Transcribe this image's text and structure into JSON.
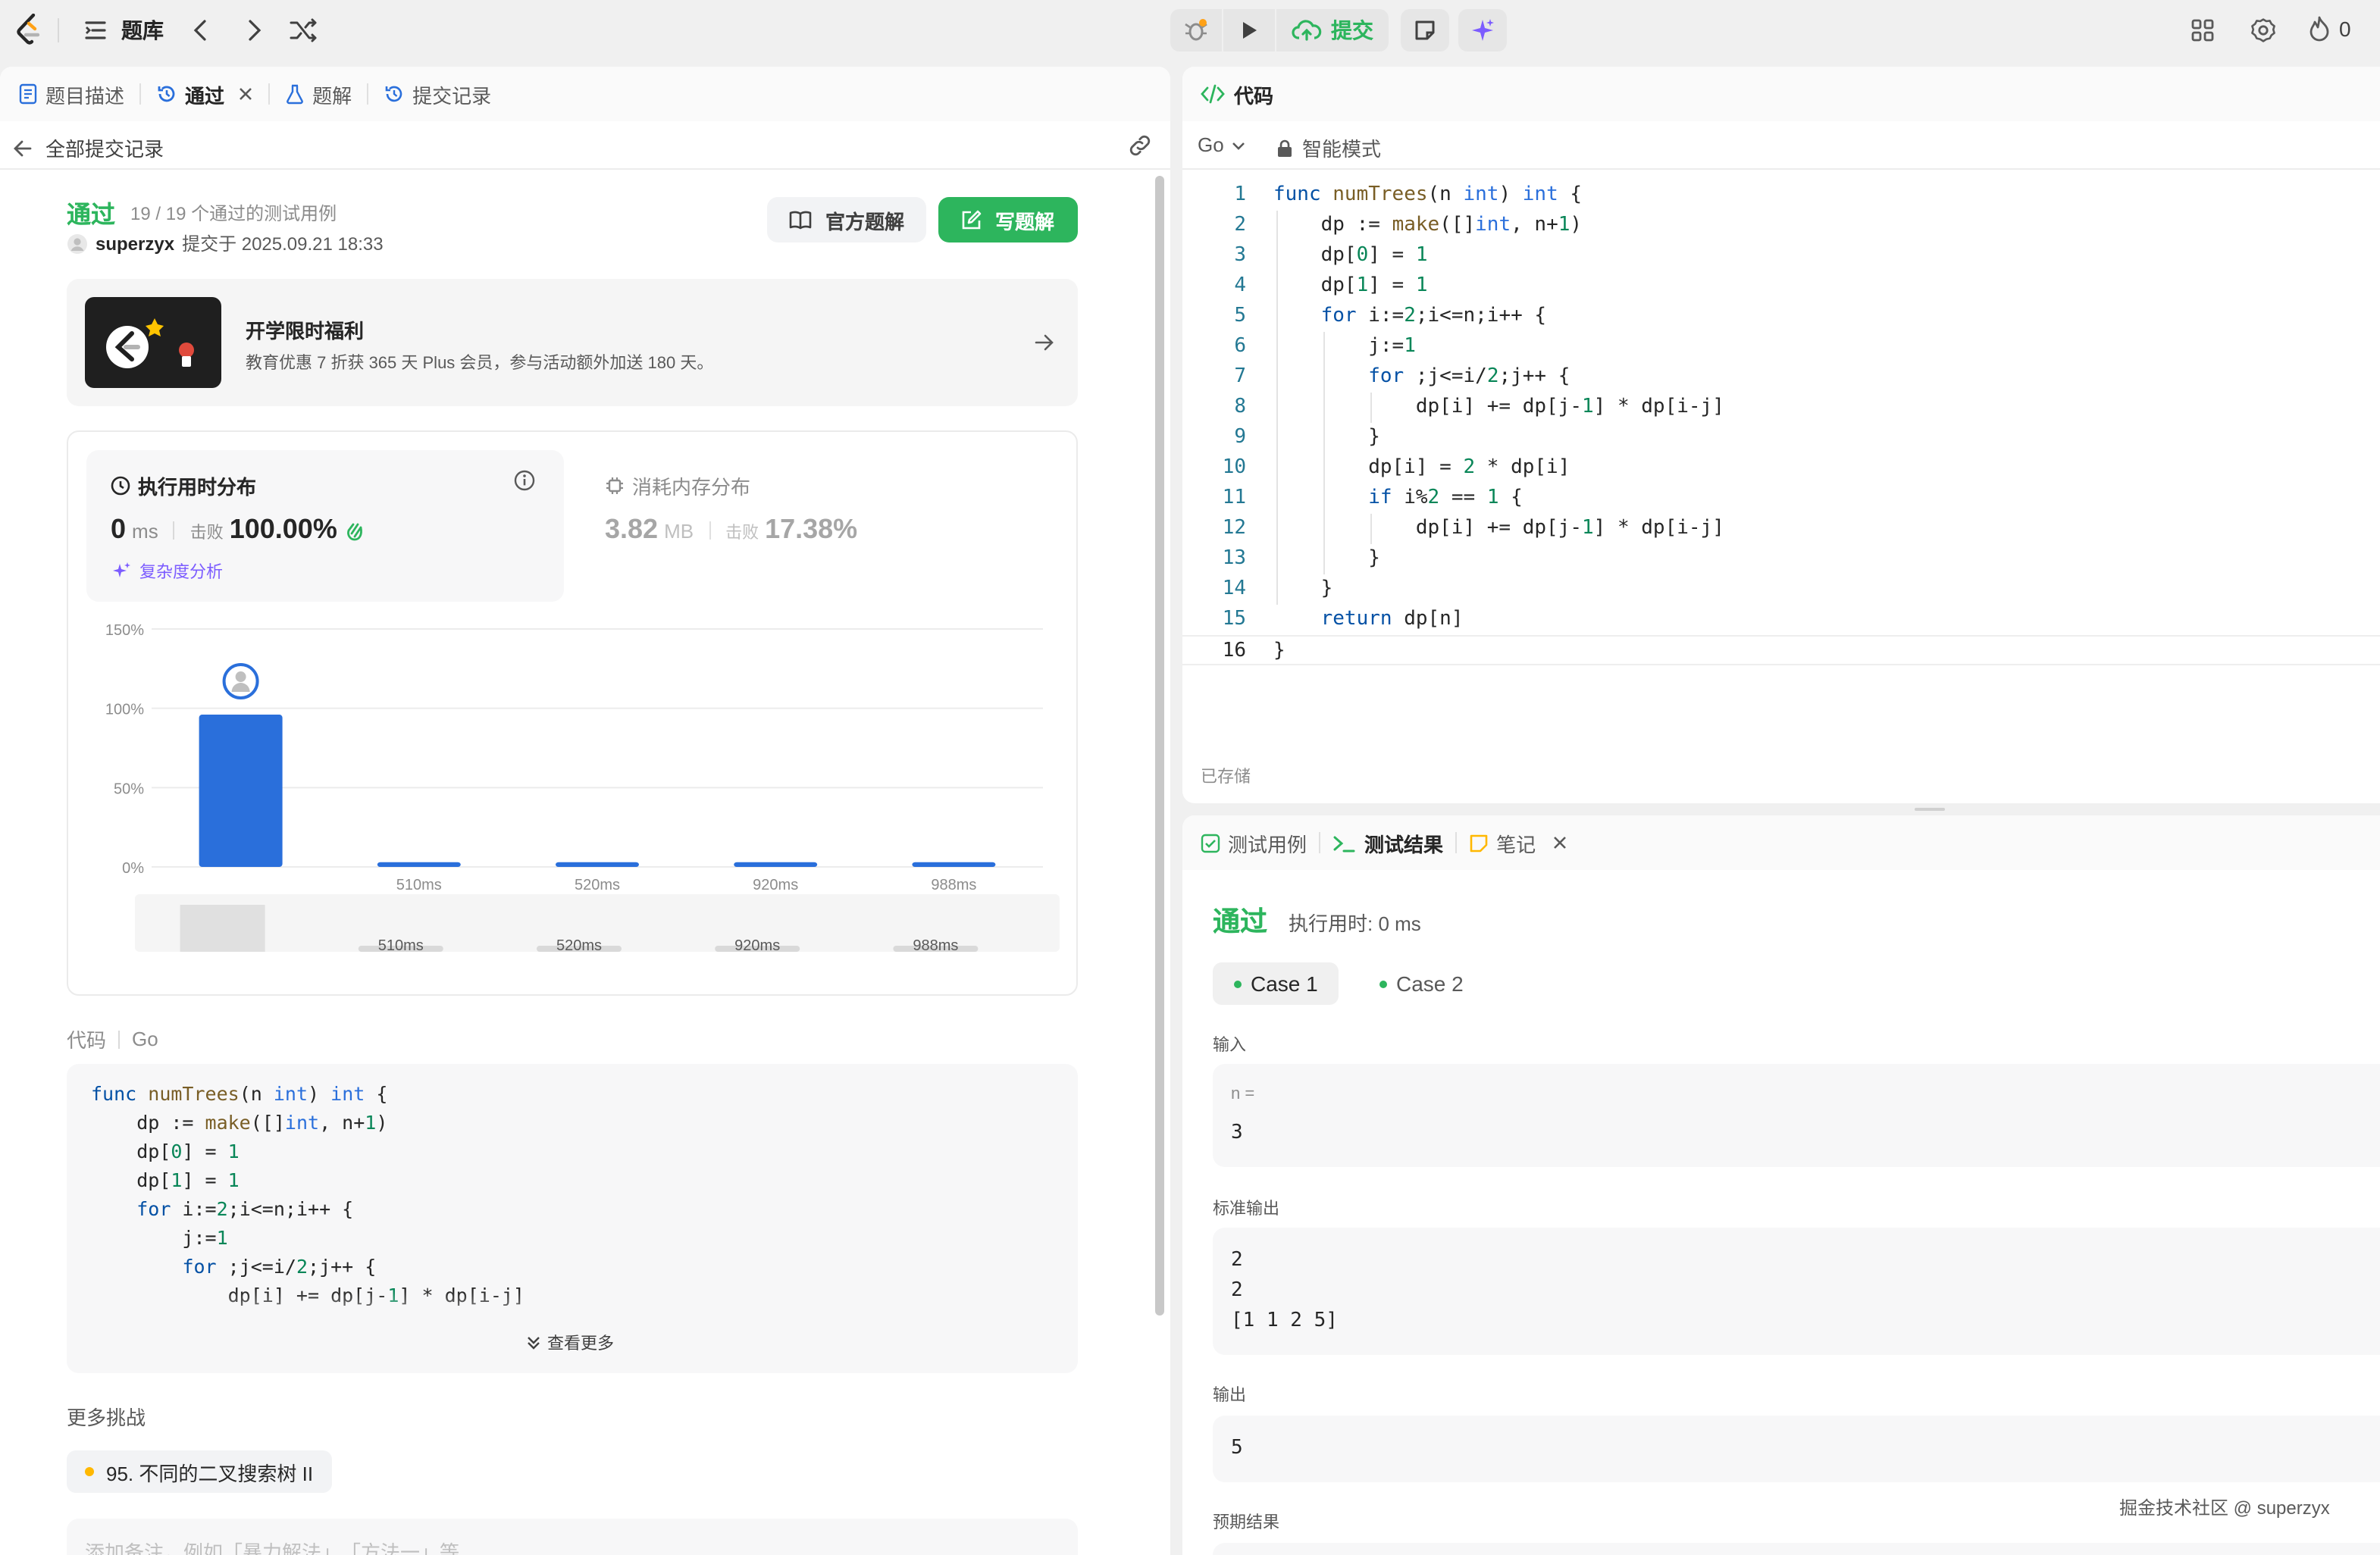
{
  "topbar": {
    "problem_bank_label": "题库",
    "submit_label": "提交",
    "flame_count": "0"
  },
  "left": {
    "tabs": [
      {
        "label": "题目描述"
      },
      {
        "label": "通过"
      },
      {
        "label": "题解"
      },
      {
        "label": "提交记录"
      }
    ],
    "back_label": "全部提交记录",
    "status": "通过",
    "passed_cases": "19 / 19 个通过的测试用例",
    "username": "superzyx",
    "submitted_at": "提交于 2025.09.21 18:33",
    "official_solution_label": "官方题解",
    "write_solution_label": "写题解",
    "promo_title": "开学限时福利",
    "promo_desc": "教育优惠 7 折获 365 天 Plus 会员，参与活动额外加送 180 天。",
    "runtime_title": "执行用时分布",
    "runtime_value": "0",
    "runtime_unit": "ms",
    "beats_label": "击败",
    "runtime_beats": "100.00%",
    "complexity_label": "复杂度分析",
    "memory_title": "消耗内存分布",
    "memory_value": "3.82",
    "memory_unit": "MB",
    "memory_beats": "17.38%",
    "code_label": "代码",
    "code_lang": "Go",
    "code_preview": [
      "func numTrees(n int) int {",
      "    dp := make([]int, n+1)",
      "    dp[0] = 1",
      "    dp[1] = 1",
      "    for i:=2;i<=n;i++ {",
      "        j:=1",
      "        for ;j<=i/2;j++ {",
      "            dp[i] += dp[j-1] * dp[i-j]"
    ],
    "see_more_label": "查看更多",
    "more_challenges_label": "更多挑战",
    "challenge_item": "95. 不同的二叉搜索树 II",
    "note_placeholder": "添加备注，例如「暴力解法」、「方法一」等"
  },
  "chart_data": {
    "type": "bar",
    "categories": [
      "0ms",
      "510ms",
      "520ms",
      "920ms",
      "988ms"
    ],
    "values": [
      96,
      3,
      3,
      3,
      3
    ],
    "y_tick_labels": [
      "150%",
      "100%",
      "50%",
      "0%"
    ],
    "ylim": [
      0,
      150
    ],
    "x_tick_labels": [
      "510ms",
      "520ms",
      "920ms",
      "988ms"
    ],
    "overview_labels": [
      "510ms",
      "520ms",
      "920ms",
      "988ms"
    ],
    "bar_color": "#2a6fdb",
    "highlight_category": "0ms",
    "grid": true
  },
  "editor": {
    "title": "代码",
    "language": "Go",
    "mode": "智能模式",
    "saved_label": "已存储",
    "code_lines": [
      "func numTrees(n int) int {",
      "    dp := make([]int, n+1)",
      "    dp[0] = 1",
      "    dp[1] = 1",
      "    for i:=2;i<=n;i++ {",
      "        j:=1",
      "        for ;j<=i/2;j++ {",
      "            dp[i] += dp[j-1] * dp[i-j]",
      "        }",
      "        dp[i] = 2 * dp[i]",
      "        if i%2 == 1 {",
      "            dp[i] += dp[j-1] * dp[i-j]",
      "        }",
      "    }",
      "    return dp[n]",
      "}"
    ],
    "line_numbers": [
      "1",
      "2",
      "3",
      "4",
      "5",
      "6",
      "7",
      "8",
      "9",
      "10",
      "11",
      "12",
      "13",
      "14",
      "15",
      "16"
    ]
  },
  "result": {
    "tabs": [
      {
        "label": "测试用例"
      },
      {
        "label": "测试结果"
      },
      {
        "label": "笔记"
      }
    ],
    "status": "通过",
    "runtime": "执行用时: 0 ms",
    "case_tabs": [
      {
        "label": "Case 1"
      },
      {
        "label": "Case 2"
      }
    ],
    "input_label": "输入",
    "input_var": "n =",
    "input_value": "3",
    "stdout_label": "标准输出",
    "stdout_lines": [
      "2",
      "2",
      "[1 1 2 5]"
    ],
    "output_label": "输出",
    "output_value": "5",
    "expected_label": "预期结果"
  },
  "watermark": "掘金技术社区 @ superzyx",
  "colors": {
    "accent_green": "#2db55d",
    "accent_blue": "#2a6fdb",
    "purple": "#7c5cff"
  }
}
